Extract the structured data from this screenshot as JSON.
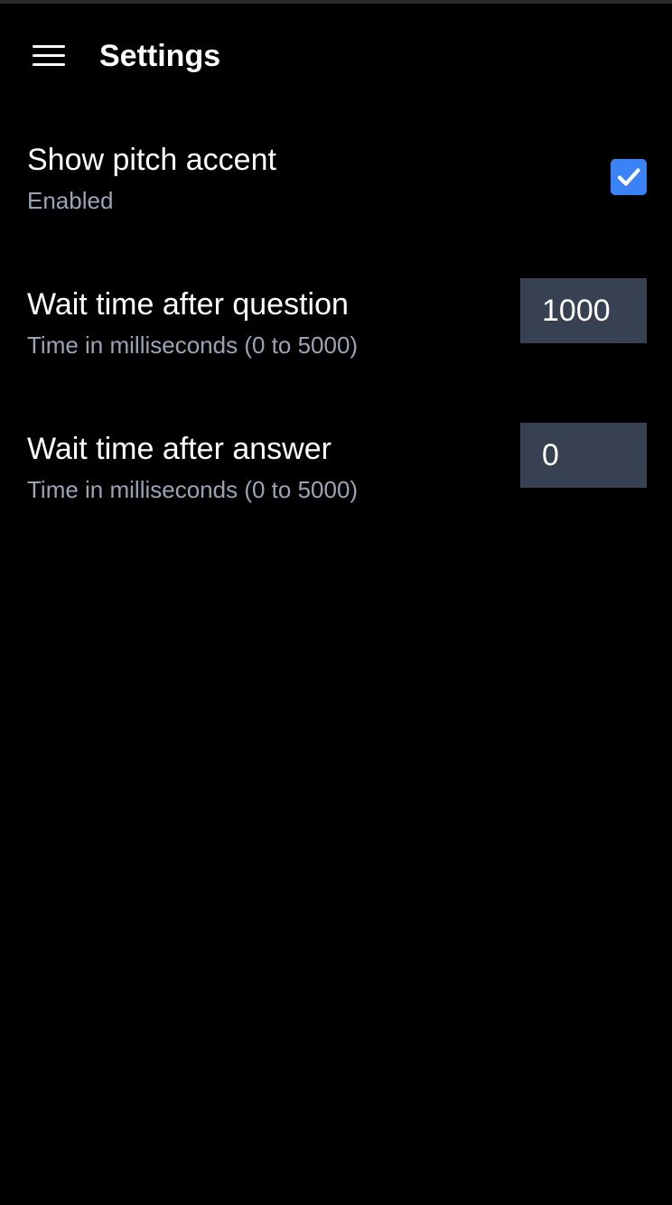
{
  "header": {
    "title": "Settings",
    "menu_icon": "hamburger-menu-icon"
  },
  "settings": {
    "pitch_accent": {
      "label": "Show pitch accent",
      "description": "Enabled",
      "checked": true,
      "accent_color": "#3b82f6"
    },
    "wait_after_question": {
      "label": "Wait time after question",
      "description": "Time in milliseconds (0 to 5000)",
      "value": "1000"
    },
    "wait_after_answer": {
      "label": "Wait time after answer",
      "description": "Time in milliseconds (0 to 5000)",
      "value": "0"
    }
  },
  "colors": {
    "background": "#000000",
    "text_primary": "#ffffff",
    "text_secondary": "#9aa4b6",
    "input_background": "#374151"
  }
}
